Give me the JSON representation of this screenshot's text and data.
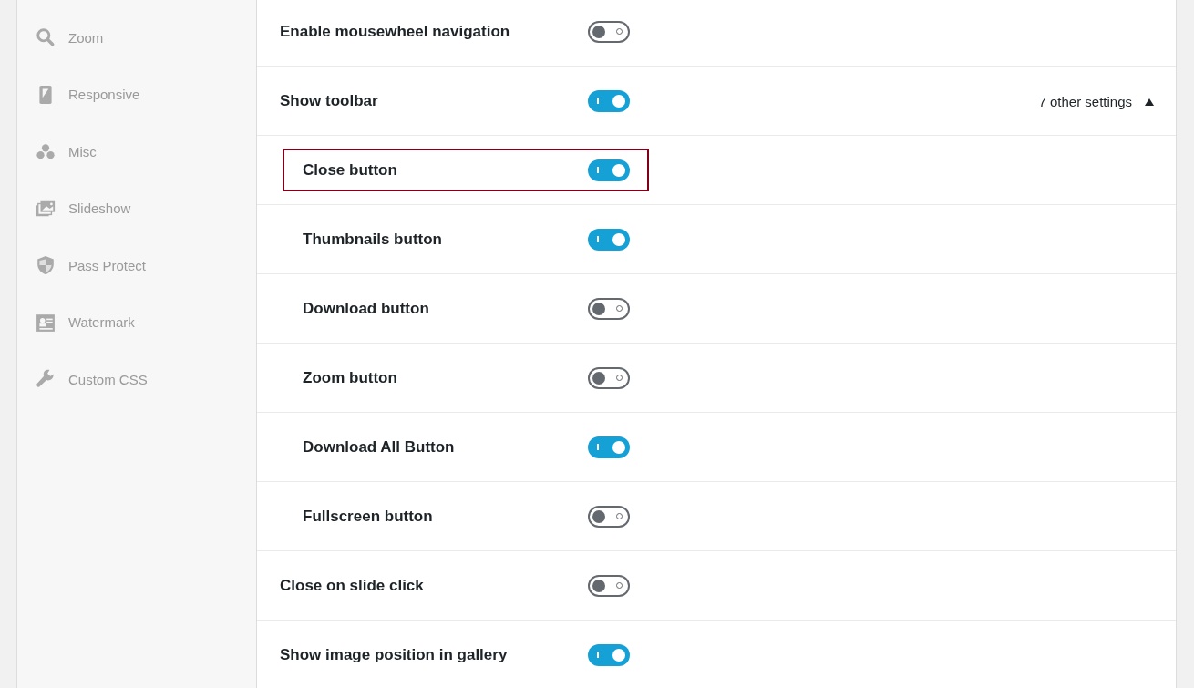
{
  "sidebar": {
    "items": [
      {
        "label": "Zoom"
      },
      {
        "label": "Responsive"
      },
      {
        "label": "Misc"
      },
      {
        "label": "Slideshow"
      },
      {
        "label": "Pass Protect"
      },
      {
        "label": "Watermark"
      },
      {
        "label": "Custom CSS"
      }
    ]
  },
  "settings": [
    {
      "label": "Enable mousewheel navigation",
      "on": false
    },
    {
      "label": "Show toolbar",
      "on": true,
      "other_settings": "7 other settings",
      "expanded": true,
      "children": [
        {
          "label": "Close button",
          "on": true,
          "highlighted": true
        },
        {
          "label": "Thumbnails button",
          "on": true,
          "highlighted": false
        },
        {
          "label": "Download button",
          "on": false,
          "highlighted": false
        },
        {
          "label": "Zoom button",
          "on": false,
          "highlighted": false
        },
        {
          "label": "Download All Button",
          "on": true,
          "highlighted": false
        },
        {
          "label": "Fullscreen button",
          "on": false,
          "highlighted": false
        }
      ]
    },
    {
      "label": "Close on slide click",
      "on": false
    },
    {
      "label": "Show image position in gallery",
      "on": true
    }
  ]
}
